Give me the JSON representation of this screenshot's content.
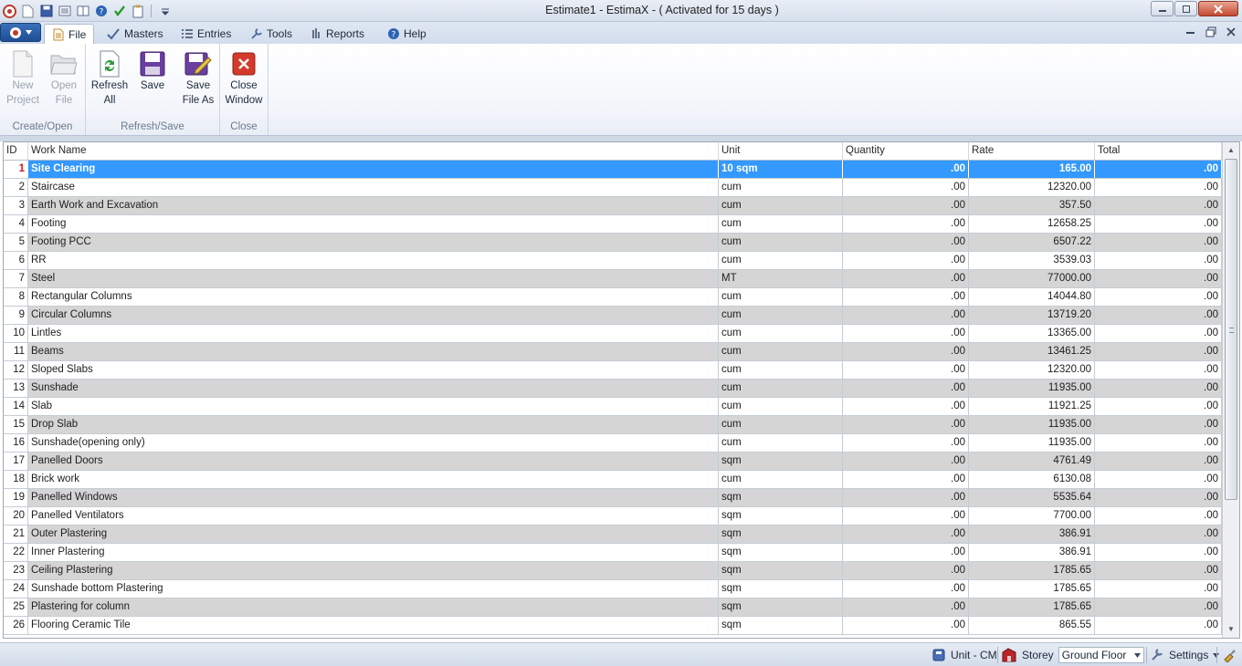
{
  "window": {
    "title": "Estimate1 - EstimaX - ( Activated for 15 days  )"
  },
  "tabs": [
    {
      "label": "File",
      "icon": "file-icon"
    },
    {
      "label": "Masters",
      "icon": "masters-icon"
    },
    {
      "label": "Entries",
      "icon": "entries-icon"
    },
    {
      "label": "Tools",
      "icon": "tools-icon"
    },
    {
      "label": "Reports",
      "icon": "reports-icon"
    },
    {
      "label": "Help",
      "icon": "help-icon"
    }
  ],
  "ribbon": {
    "new_project": "New\nProject",
    "open_file": "Open\nFile",
    "refresh_all": "Refresh\nAll",
    "save": "Save",
    "save_file_as": "Save\nFile As",
    "close_window": "Close\nWindow",
    "group_create_open": "Create/Open",
    "group_refresh_save": "Refresh/Save",
    "group_close": "Close"
  },
  "grid": {
    "headers": {
      "id": "ID",
      "name": "Work Name",
      "unit": "Unit",
      "qty": "Quantity",
      "rate": "Rate",
      "total": "Total"
    },
    "rows": [
      {
        "id": "1",
        "name": "Site Clearing",
        "unit": "10 sqm",
        "qty": ".00",
        "rate": "165.00",
        "total": ".00"
      },
      {
        "id": "2",
        "name": "Staircase",
        "unit": "cum",
        "qty": ".00",
        "rate": "12320.00",
        "total": ".00"
      },
      {
        "id": "3",
        "name": "Earth Work and Excavation",
        "unit": "cum",
        "qty": ".00",
        "rate": "357.50",
        "total": ".00"
      },
      {
        "id": "4",
        "name": "Footing",
        "unit": "cum",
        "qty": ".00",
        "rate": "12658.25",
        "total": ".00"
      },
      {
        "id": "5",
        "name": "Footing PCC",
        "unit": " cum",
        "qty": ".00",
        "rate": "6507.22",
        "total": ".00"
      },
      {
        "id": "6",
        "name": "RR",
        "unit": "cum",
        "qty": ".00",
        "rate": "3539.03",
        "total": ".00"
      },
      {
        "id": "7",
        "name": "Steel",
        "unit": "MT",
        "qty": ".00",
        "rate": "77000.00",
        "total": ".00"
      },
      {
        "id": "8",
        "name": "Rectangular Columns",
        "unit": "cum",
        "qty": ".00",
        "rate": "14044.80",
        "total": ".00"
      },
      {
        "id": "9",
        "name": "Circular Columns",
        "unit": "cum",
        "qty": ".00",
        "rate": "13719.20",
        "total": ".00"
      },
      {
        "id": "10",
        "name": "Lintles",
        "unit": "cum",
        "qty": ".00",
        "rate": "13365.00",
        "total": ".00"
      },
      {
        "id": "11",
        "name": "Beams",
        "unit": "cum",
        "qty": ".00",
        "rate": "13461.25",
        "total": ".00"
      },
      {
        "id": "12",
        "name": "Sloped Slabs",
        "unit": "cum",
        "qty": ".00",
        "rate": "12320.00",
        "total": ".00"
      },
      {
        "id": "13",
        "name": "Sunshade",
        "unit": "cum",
        "qty": ".00",
        "rate": "11935.00",
        "total": ".00"
      },
      {
        "id": "14",
        "name": "Slab",
        "unit": "cum",
        "qty": ".00",
        "rate": "11921.25",
        "total": ".00"
      },
      {
        "id": "15",
        "name": "Drop Slab",
        "unit": "cum",
        "qty": ".00",
        "rate": "11935.00",
        "total": ".00"
      },
      {
        "id": "16",
        "name": "Sunshade(opening only)",
        "unit": "cum",
        "qty": ".00",
        "rate": "11935.00",
        "total": ".00"
      },
      {
        "id": "17",
        "name": "Panelled Doors",
        "unit": "sqm",
        "qty": ".00",
        "rate": "4761.49",
        "total": ".00"
      },
      {
        "id": "18",
        "name": "Brick work",
        "unit": "cum",
        "qty": ".00",
        "rate": "6130.08",
        "total": ".00"
      },
      {
        "id": "19",
        "name": "Panelled Windows",
        "unit": "sqm",
        "qty": ".00",
        "rate": "5535.64",
        "total": ".00"
      },
      {
        "id": "20",
        "name": "Panelled Ventilators",
        "unit": "sqm",
        "qty": ".00",
        "rate": "7700.00",
        "total": ".00"
      },
      {
        "id": "21",
        "name": "Outer Plastering",
        "unit": "sqm",
        "qty": ".00",
        "rate": "386.91",
        "total": ".00"
      },
      {
        "id": "22",
        "name": "Inner Plastering",
        "unit": "sqm",
        "qty": ".00",
        "rate": "386.91",
        "total": ".00"
      },
      {
        "id": "23",
        "name": "Ceiling Plastering",
        "unit": "sqm",
        "qty": ".00",
        "rate": "1785.65",
        "total": ".00"
      },
      {
        "id": "24",
        "name": "Sunshade bottom Plastering",
        "unit": "sqm",
        "qty": ".00",
        "rate": "1785.65",
        "total": ".00"
      },
      {
        "id": "25",
        "name": "Plastering for column",
        "unit": "sqm",
        "qty": ".00",
        "rate": "1785.65",
        "total": ".00"
      },
      {
        "id": "26",
        "name": "Flooring Ceramic Tile",
        "unit": "sqm",
        "qty": ".00",
        "rate": "865.55",
        "total": ".00"
      }
    ]
  },
  "status": {
    "unit_label": "Unit - CM",
    "storey_label": "Storey",
    "storey_value": "Ground Floor",
    "settings_label": "Settings"
  },
  "colors": {
    "selection": "#3399ff",
    "alt_row": "#d5d5d5",
    "selected_id": "#d21a1a"
  }
}
